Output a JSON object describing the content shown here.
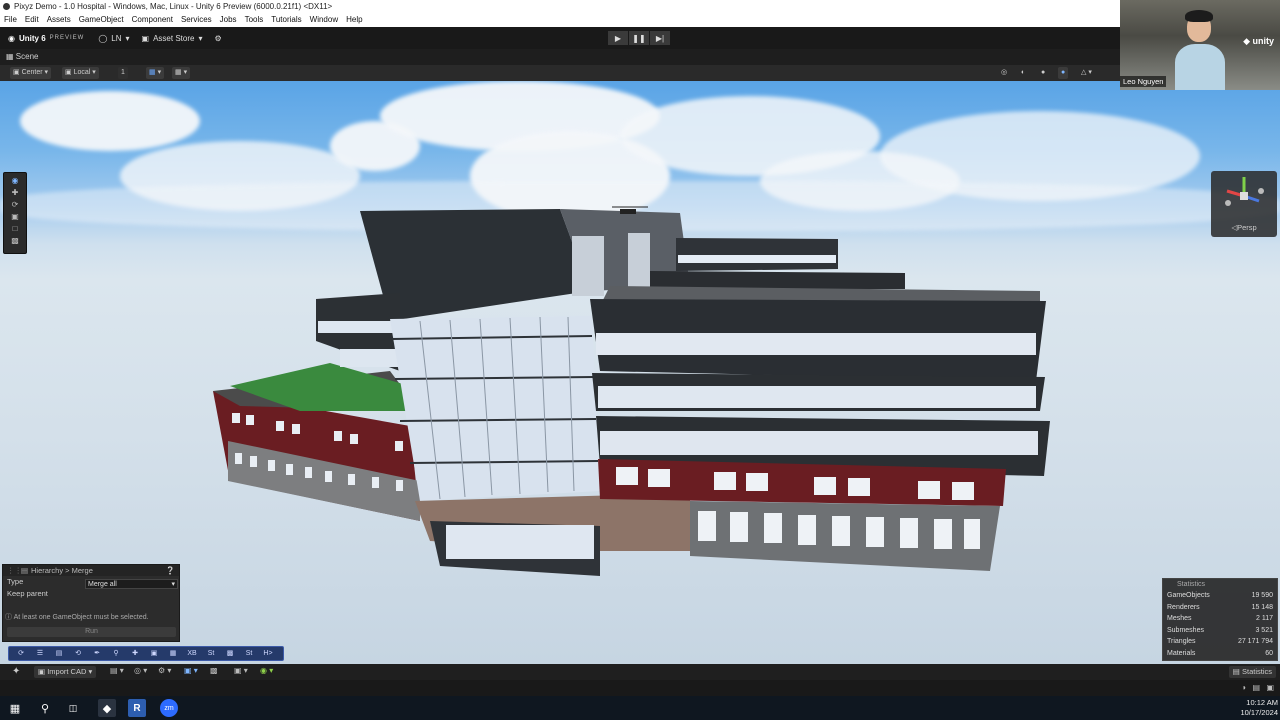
{
  "window": {
    "title": "Pixyz Demo - 1.0 Hospital - Windows, Mac, Linux - Unity 6 Preview (6000.0.21f1) <DX11>"
  },
  "menu": [
    "File",
    "Edit",
    "Assets",
    "GameObject",
    "Component",
    "Services",
    "Jobs",
    "Tools",
    "Tutorials",
    "Window",
    "Help"
  ],
  "toolbar": {
    "brand": "Unity 6",
    "preview": "PREVIEW",
    "account": "LN",
    "asset_store": "Asset Store"
  },
  "scene": {
    "tab_label": "Scene",
    "pivot_mode": "Center",
    "pivot_rotation": "Local",
    "grid_value": "1",
    "camera_mode": "◁Persp"
  },
  "webcam": {
    "name": "Leo Nguyen",
    "logo": "unity"
  },
  "merge_panel": {
    "title": "Hierarchy > Merge",
    "type_label": "Type",
    "type_value": "Merge all",
    "keep_parent_label": "Keep parent",
    "warning": "At least one GameObject must be selected.",
    "run_label": "Run"
  },
  "overlay_toolbar": {
    "labels": [
      "XB",
      "St",
      "St",
      "H>"
    ]
  },
  "statistics": {
    "title": "Statistics",
    "rows": [
      {
        "label": "GameObjects",
        "value": "19 590"
      },
      {
        "label": "Renderers",
        "value": "15 148"
      },
      {
        "label": "Meshes",
        "value": "2 117"
      },
      {
        "label": "Submeshes",
        "value": "3 521"
      },
      {
        "label": "Triangles",
        "value": "27 171 794"
      },
      {
        "label": "Materials",
        "value": "60"
      }
    ]
  },
  "pixyz_bar": {
    "import_label": "Import CAD",
    "stats_label": "Statistics"
  },
  "taskbar": {
    "time": "10:12 AM",
    "date": "10/17/2024"
  }
}
